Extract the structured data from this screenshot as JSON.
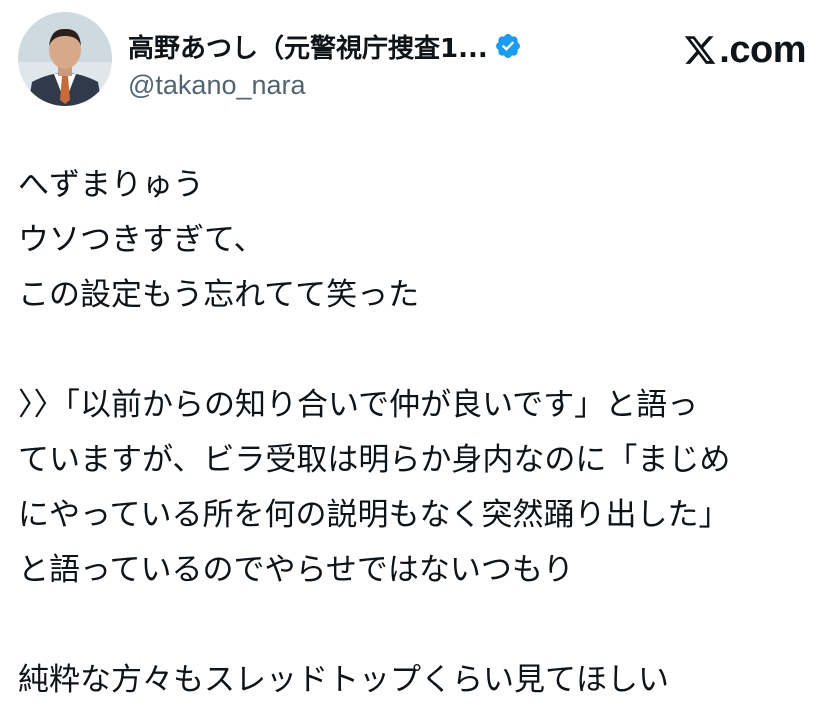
{
  "header": {
    "display_name": "高野あつし（元警視庁捜査1...",
    "handle": "@takano_nara",
    "brand": ".com",
    "avatar_icon": "profile-photo",
    "verified_icon": "verified-badge-icon",
    "verified_color": "#1d9bf0"
  },
  "tweet": {
    "lines": [
      "へずまりゅう",
      "ウソつきすぎて、",
      "この設定もう忘れてて笑った",
      "",
      "〉〉「以前からの知り合いで仲が良いです」と語っ",
      "ていますが、ビラ受取は明らか身内なのに「まじめ",
      "にやっている所を何の説明もなく突然踊り出した」",
      "と語っているのでやらせではないつもり",
      "",
      "純粋な方々もスレッドトップくらい見てほしい"
    ]
  }
}
